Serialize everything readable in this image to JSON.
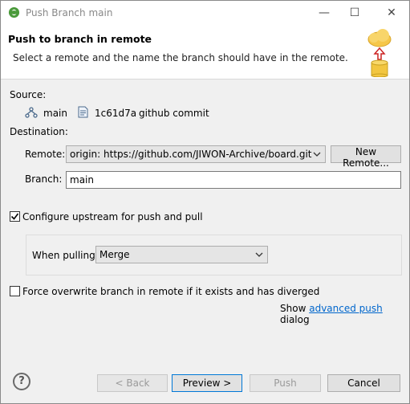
{
  "window": {
    "title": "Push Branch main",
    "icon": "eclipse-icon",
    "controls": {
      "minimize": "—",
      "maximize": "☐",
      "close": "✕"
    }
  },
  "header": {
    "title": "Push to branch in remote",
    "description": "Select a remote and the name the branch should have in the remote."
  },
  "source": {
    "label": "Source:",
    "branch": "main",
    "commit_id": "1c61d7a",
    "commit_message": "github commit"
  },
  "destination": {
    "label": "Destination:",
    "remote_label": "Remote:",
    "remote_value": "origin: https://github.com/JIWON-Archive/board.git",
    "new_remote_label": "New Remote...",
    "branch_label": "Branch:",
    "branch_value": "main"
  },
  "upstream": {
    "label": "Configure upstream for push and pull",
    "checked": true,
    "when_pulling_label": "When pulling:",
    "when_pulling_value": "Merge"
  },
  "force": {
    "label": "Force overwrite branch in remote if it exists and has diverged",
    "checked": false
  },
  "advanced": {
    "prefix": "Show",
    "link": "advanced push",
    "suffix": "dialog"
  },
  "buttons": {
    "help": "?",
    "back": "< Back",
    "preview": "Preview >",
    "push": "Push",
    "cancel": "Cancel"
  },
  "colors": {
    "accent": "#0078d7",
    "link": "#0066cc",
    "checkmark": "#000000"
  }
}
